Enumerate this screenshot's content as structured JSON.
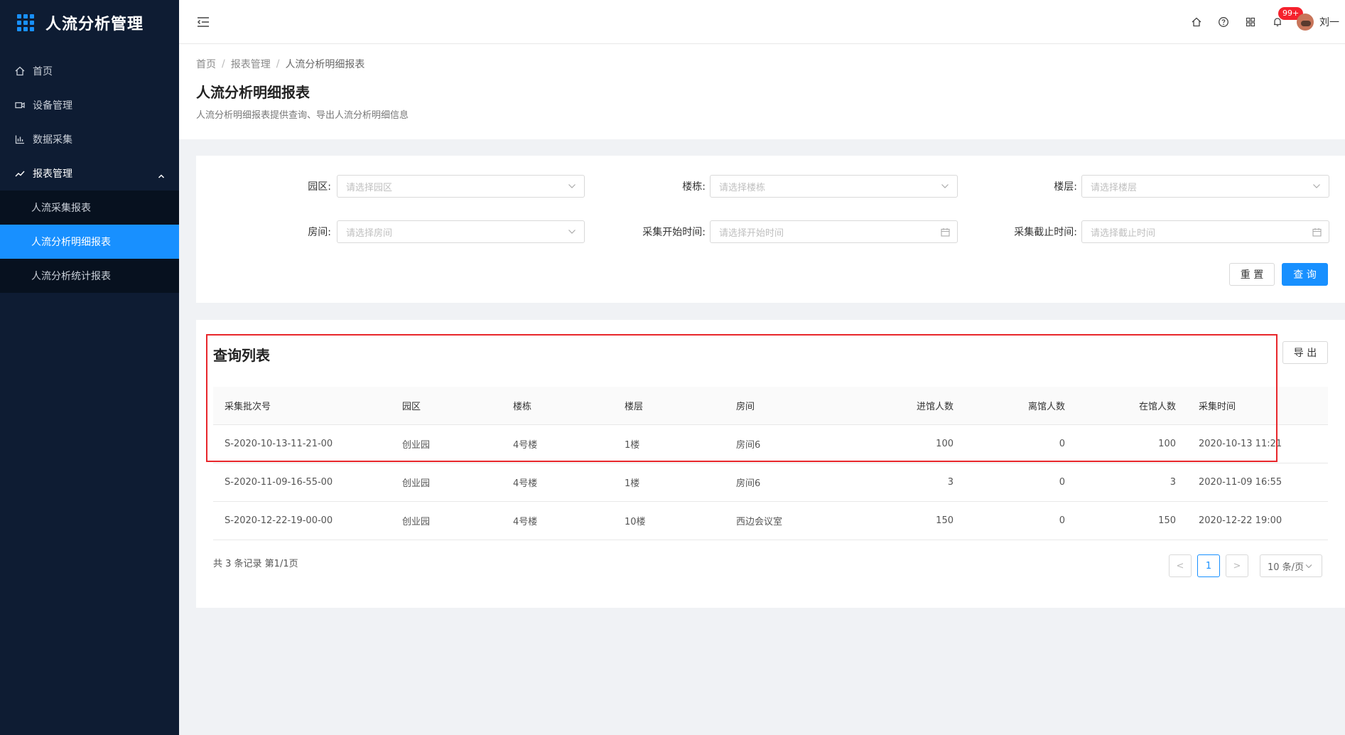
{
  "app": {
    "title": "人流分析管理"
  },
  "sidebar": {
    "items": [
      {
        "label": "首页"
      },
      {
        "label": "设备管理"
      },
      {
        "label": "数据采集"
      },
      {
        "label": "报表管理"
      }
    ],
    "sub_items": [
      {
        "label": "人流采集报表"
      },
      {
        "label": "人流分析明细报表"
      },
      {
        "label": "人流分析统计报表"
      }
    ]
  },
  "header": {
    "badge": "99+",
    "user_name": "刘一"
  },
  "breadcrumb": [
    "首页",
    "报表管理",
    "人流分析明细报表"
  ],
  "page": {
    "title": "人流分析明细报表",
    "description": "人流分析明细报表提供查询、导出人流分析明细信息"
  },
  "filters": {
    "park_label": "园区:",
    "park_placeholder": "请选择园区",
    "building_label": "楼栋:",
    "building_placeholder": "请选择楼栋",
    "floor_label": "楼层:",
    "floor_placeholder": "请选择楼层",
    "room_label": "房间:",
    "room_placeholder": "请选择房间",
    "start_label": "采集开始时间:",
    "start_placeholder": "请选择开始时间",
    "end_label": "采集截止时间:",
    "end_placeholder": "请选择截止时间",
    "reset_label": "重 置",
    "query_label": "查 询"
  },
  "table": {
    "title": "查询列表",
    "export_label": "导 出",
    "columns": [
      "采集批次号",
      "园区",
      "楼栋",
      "楼层",
      "房间",
      "进馆人数",
      "离馆人数",
      "在馆人数",
      "采集时间"
    ],
    "rows": [
      [
        "S-2020-10-13-11-21-00",
        "创业园",
        "4号楼",
        "1楼",
        "房间6",
        "100",
        "0",
        "100",
        "2020-10-13 11:21"
      ],
      [
        "S-2020-11-09-16-55-00",
        "创业园",
        "4号楼",
        "1楼",
        "房间6",
        "3",
        "0",
        "3",
        "2020-11-09 16:55"
      ],
      [
        "S-2020-12-22-19-00-00",
        "创业园",
        "4号楼",
        "10楼",
        "西边会议室",
        "150",
        "0",
        "150",
        "2020-12-22 19:00"
      ]
    ],
    "summary": "共 3 条记录 第1/1页"
  },
  "pagination": {
    "prev": "<",
    "current": "1",
    "next": ">",
    "page_size": "10 条/页"
  },
  "colors": {
    "sidebar_bg": "#0e1c33",
    "accent": "#1890ff",
    "highlight": "#e8262b"
  }
}
